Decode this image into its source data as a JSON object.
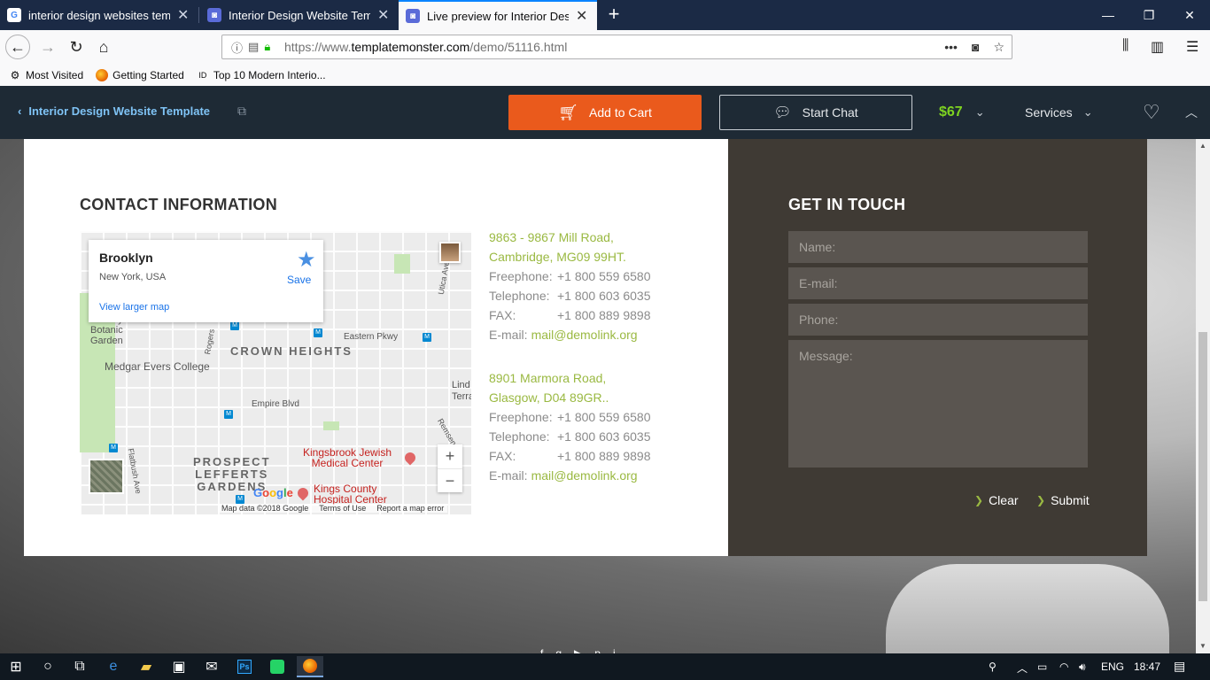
{
  "browser": {
    "tabs": [
      {
        "title": "interior design websites templa",
        "favicon": "G"
      },
      {
        "title": "Interior Design Website Templa",
        "favicon": "tm"
      },
      {
        "title": "Live preview for Interior Design",
        "favicon": "tm"
      }
    ],
    "url_prefix": "https://www.",
    "url_domain": "templatemonster.com",
    "url_path": "/demo/51116.html",
    "bookmarks": [
      "Most Visited",
      "Getting Started",
      "Top 10 Modern Interio..."
    ]
  },
  "tm_bar": {
    "back_label": "Interior Design Website Template",
    "cart_label": "Add to Cart",
    "chat_label": "Start Chat",
    "price": "$67",
    "services_label": "Services"
  },
  "contact": {
    "heading": "CONTACT INFORMATION",
    "map": {
      "place": "Brooklyn",
      "address": "New York, USA",
      "save_label": "Save",
      "larger_map_label": "View larger map",
      "labels": {
        "botanic": "Brooklyn\nBotanic\nGarden",
        "medgar": "Medgar Evers College",
        "crown": "CROWN HEIGHTS",
        "eastern": "Eastern Pkwy",
        "empire": "Empire Blvd",
        "prospect": "PROSPECT\nLEFFERTS\nGARDENS",
        "kingsbrook": "Kingsbrook Jewish\nMedical Center",
        "kingscounty": "Kings County\nHospital Center",
        "rogers": "Rogers",
        "utica": "Utica Ave",
        "flatbush": "Flatbush Ave",
        "remsen": "Remsen",
        "linden": "Lind\nTerrac"
      },
      "footer": [
        "Map data ©2018 Google",
        "Terms of Use",
        "Report a map error"
      ],
      "logo": "Google"
    },
    "offices": [
      {
        "address_line1": "9863 - 9867 Mill Road,",
        "address_line2": "Cambridge, MG09 99HT.",
        "freephone_label": "Freephone:",
        "freephone": "+1 800 559 6580",
        "telephone_label": "Telephone:",
        "telephone": "+1 800 603 6035",
        "fax_label": "FAX:",
        "fax": "+1 800 889 9898",
        "email_label": "E-mail:",
        "email": "mail@demolink.org"
      },
      {
        "address_line1": "8901 Marmora Road,",
        "address_line2": "Glasgow, D04 89GR..",
        "freephone_label": "Freephone:",
        "freephone": "+1 800 559 6580",
        "telephone_label": "Telephone:",
        "telephone": "+1 800 603 6035",
        "fax_label": "FAX:",
        "fax": "+1 800 889 9898",
        "email_label": "E-mail:",
        "email": "mail@demolink.org"
      }
    ]
  },
  "get_in_touch": {
    "heading": "GET IN TOUCH",
    "name_placeholder": "Name:",
    "email_placeholder": "E-mail:",
    "phone_placeholder": "Phone:",
    "message_placeholder": "Message:",
    "clear_label": "Clear",
    "submit_label": "Submit"
  },
  "taskbar": {
    "language": "ENG",
    "time": "18:47"
  },
  "colors": {
    "accent_orange": "#ea5a1c",
    "price_green": "#7ed321",
    "link_green": "#9ab942",
    "dark_panel": "#3f3a34"
  }
}
